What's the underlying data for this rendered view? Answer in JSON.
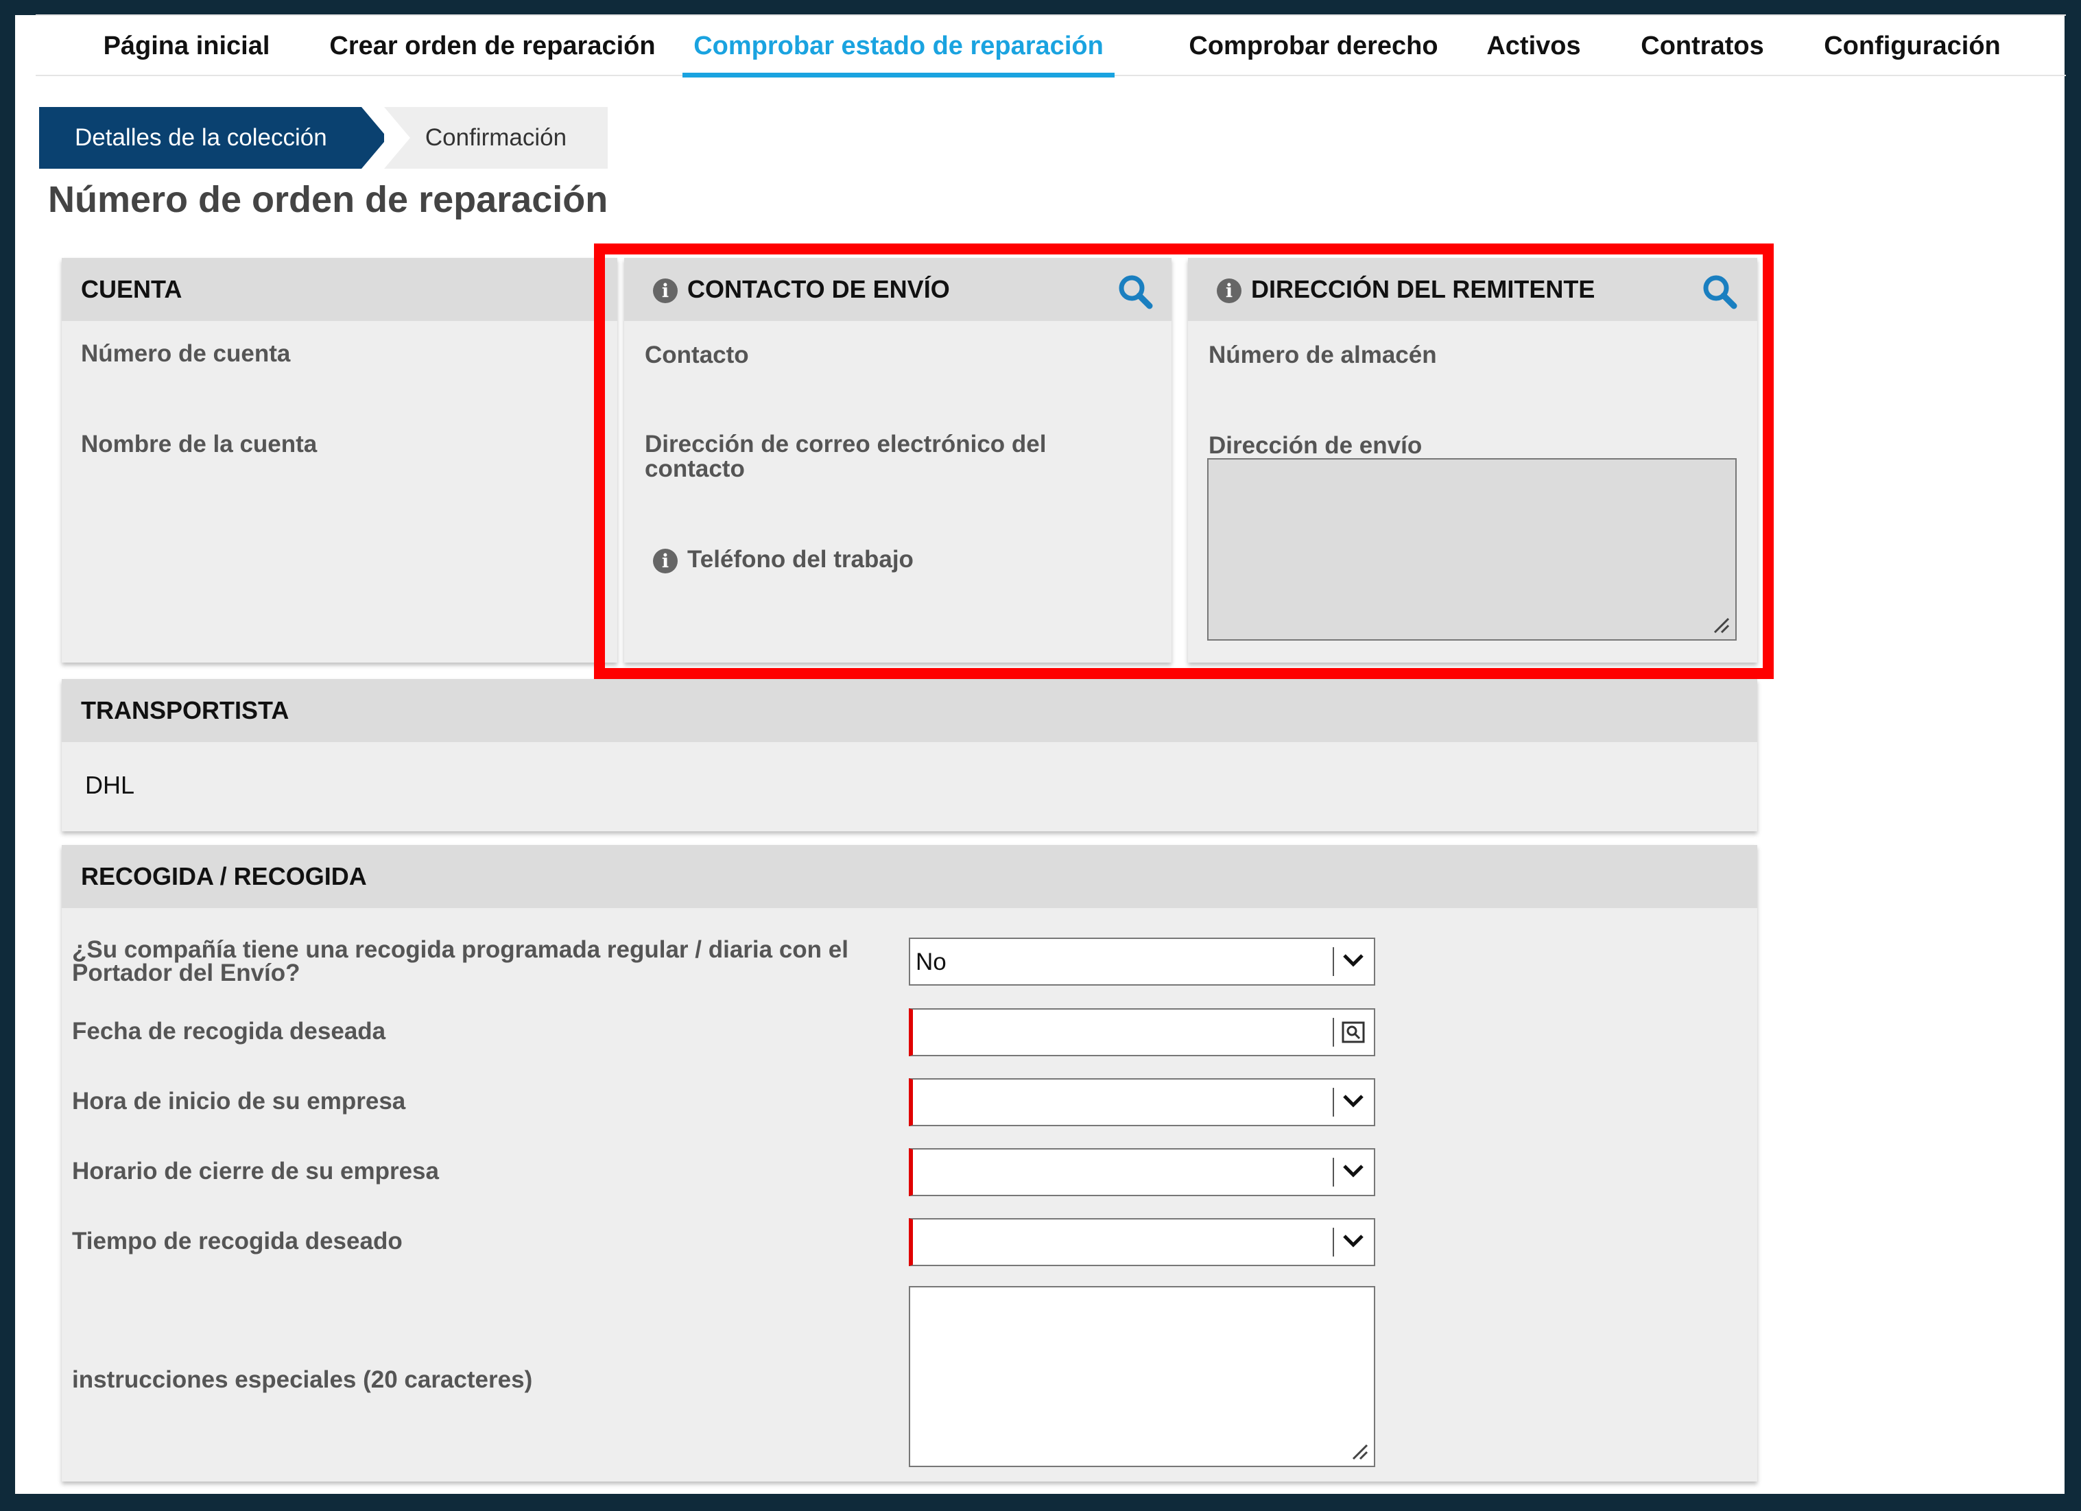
{
  "nav": {
    "items": [
      {
        "label": "Página inicial"
      },
      {
        "label": "Crear orden de reparación"
      },
      {
        "label": "Comprobar estado de reparación",
        "active": true
      },
      {
        "label": "Comprobar derecho"
      },
      {
        "label": "Activos"
      },
      {
        "label": "Contratos"
      },
      {
        "label": "Configuración"
      }
    ]
  },
  "steps": {
    "current": "Detalles de la colección",
    "next": "Confirmación"
  },
  "page_title": "Número de orden de reparación",
  "cuenta": {
    "title": "CUENTA",
    "account_number_label": "Número de cuenta",
    "account_name_label": "Nombre de la cuenta"
  },
  "contacto": {
    "title": "CONTACTO DE ENVÍO",
    "contact_label": "Contacto",
    "email_label_line1": "Dirección de correo electrónico del",
    "email_label_line2": "contacto",
    "phone_label": "Teléfono del trabajo"
  },
  "remitente": {
    "title": "DIRECCIÓN DEL REMITENTE",
    "warehouse_label": "Número de almacén",
    "address_label": "Dirección de envío",
    "address_value": ""
  },
  "transportista": {
    "title": "TRANSPORTISTA",
    "value": "DHL"
  },
  "recogida": {
    "title": "RECOGIDA / RECOGIDA",
    "q_line1": "¿Su compañía tiene una recogida programada regular / diaria con el",
    "q_line2": "Portador del Envío?",
    "q_value": "No",
    "date_label": "Fecha de recogida deseada",
    "date_value": "",
    "start_label": "Hora de inicio de su empresa",
    "start_value": "",
    "close_label": "Horario de cierre de su empresa",
    "close_value": "",
    "pickup_label": "Tiempo de recogida deseado",
    "pickup_value": "",
    "instructions_label": "instrucciones especiales (20 caracteres)",
    "instructions_value": ""
  },
  "colors": {
    "accent": "#1aa3e0",
    "step_active": "#0a4170",
    "highlight": "#ff0000",
    "required": "#e00000",
    "search_icon": "#1a7fc0"
  },
  "icons": [
    "search-icon",
    "info-icon",
    "chevron-down-icon",
    "calendar-icon",
    "resize-handle-icon"
  ]
}
